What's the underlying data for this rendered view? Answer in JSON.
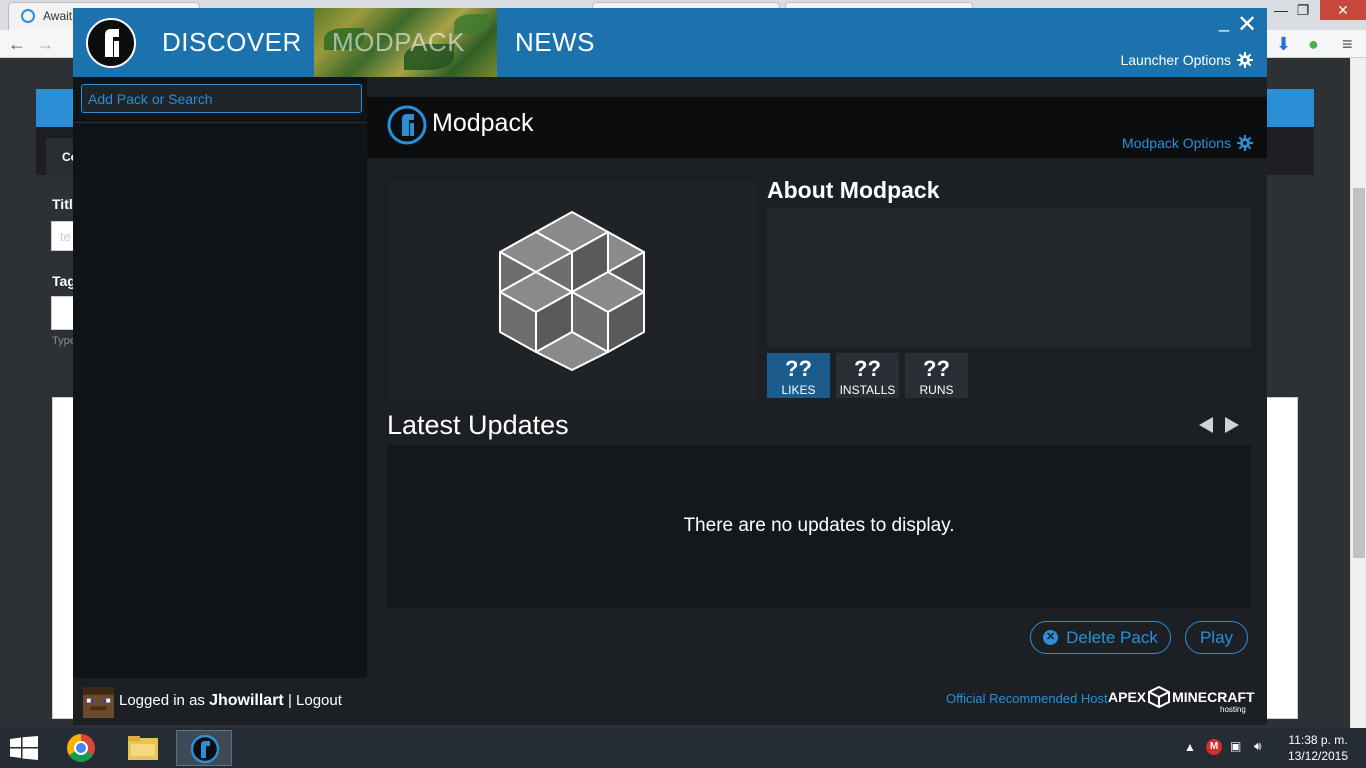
{
  "browser": {
    "tab1_title": "Awaiti",
    "window_min": "—",
    "window_max": "❐",
    "window_close": "✕"
  },
  "background_page": {
    "tab_label": "Co",
    "label_title": "Titl",
    "label_tags": "Tag",
    "input_placeholder": "te",
    "hint_text": "Type"
  },
  "launcher": {
    "nav": {
      "discover": "DISCOVER",
      "modpack": "MODPACK",
      "news": "NEWS"
    },
    "window_minimize": "_",
    "window_close": "✕",
    "launcher_options": "Launcher Options",
    "sidebar": {
      "search_placeholder": "Add Pack or Search"
    },
    "pack": {
      "title": "Modpack",
      "options": "Modpack Options",
      "about_title": "About Modpack",
      "stats": [
        {
          "value": "??",
          "label": "LIKES"
        },
        {
          "value": "??",
          "label": "INSTALLS"
        },
        {
          "value": "??",
          "label": "RUNS"
        }
      ],
      "updates_title": "Latest Updates",
      "updates_empty": "There are no updates to display.",
      "delete_label": "Delete Pack",
      "play_label": "Play"
    },
    "footer": {
      "logged_in_prefix": "Logged in as",
      "username": "Jhowillart",
      "separator": "|",
      "logout": "Logout",
      "host_label": "Official Recommended Host",
      "host_brand_left": "APEX",
      "host_brand_right": "MINECRAFT",
      "host_brand_sub": "hosting"
    },
    "colors": {
      "accent": "#2b8fd6",
      "header": "#1b72ad",
      "background": "#1c2025"
    }
  },
  "taskbar": {
    "time": "11:38 p. m.",
    "date": "13/12/2015"
  }
}
